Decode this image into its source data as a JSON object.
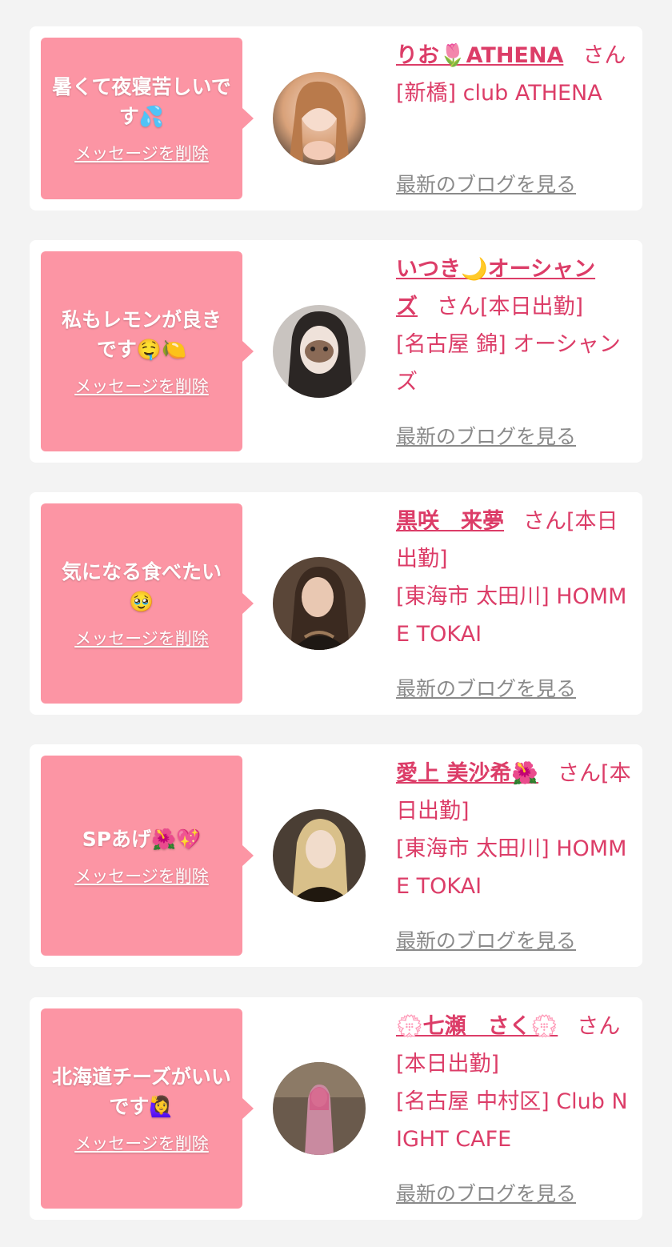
{
  "colors": {
    "page_background": "#f3f3f3",
    "card_background": "#ffffff",
    "bubble_pink": "#fc95a4",
    "name_pink": "#dc3d68",
    "link_gray": "#8a8a8a"
  },
  "cards": [
    {
      "message": "暑くて夜寝苦しいです💦",
      "delete_label": "メッセージを削除",
      "avatar_icon": "cast-photo-1",
      "cast_name": "りお🌷ATHENA",
      "honorific": "さん",
      "status": "",
      "shop": "[新橋] club ATHENA",
      "blog_label": "最新のブログを見る"
    },
    {
      "message": "私もレモンが良きです🤤🍋",
      "delete_label": "メッセージを削除",
      "avatar_icon": "cast-photo-2",
      "cast_name": "いつき🌙オーシャンズ",
      "honorific": "さん",
      "status": "[本日出勤]",
      "shop": "[名古屋 錦] オーシャンズ",
      "blog_label": "最新のブログを見る"
    },
    {
      "message": "気になる食べたい🥹",
      "delete_label": "メッセージを削除",
      "avatar_icon": "cast-photo-3",
      "cast_name": "黒咲　来夢",
      "honorific": "さん",
      "status": "[本日出勤]",
      "shop": "[東海市 太田川] HOMME TOKAI",
      "blog_label": "最新のブログを見る"
    },
    {
      "message": "SPあげ🌺💖",
      "delete_label": "メッセージを削除",
      "avatar_icon": "cast-photo-4",
      "cast_name": "愛上 美沙希🌺",
      "honorific": "さん",
      "status": "[本日出勤]",
      "shop": "[東海市 太田川] HOMME TOKAI",
      "blog_label": "最新のブログを見る"
    },
    {
      "message": "北海道チーズがいいです🙋‍♀️",
      "delete_label": "メッセージを削除",
      "avatar_icon": "cast-photo-5",
      "cast_name": "💮七瀬　さく💮",
      "honorific": "さん",
      "status": "[本日出勤]",
      "shop": "[名古屋 中村区] Club NIGHT CAFE",
      "blog_label": "最新のブログを見る"
    }
  ]
}
